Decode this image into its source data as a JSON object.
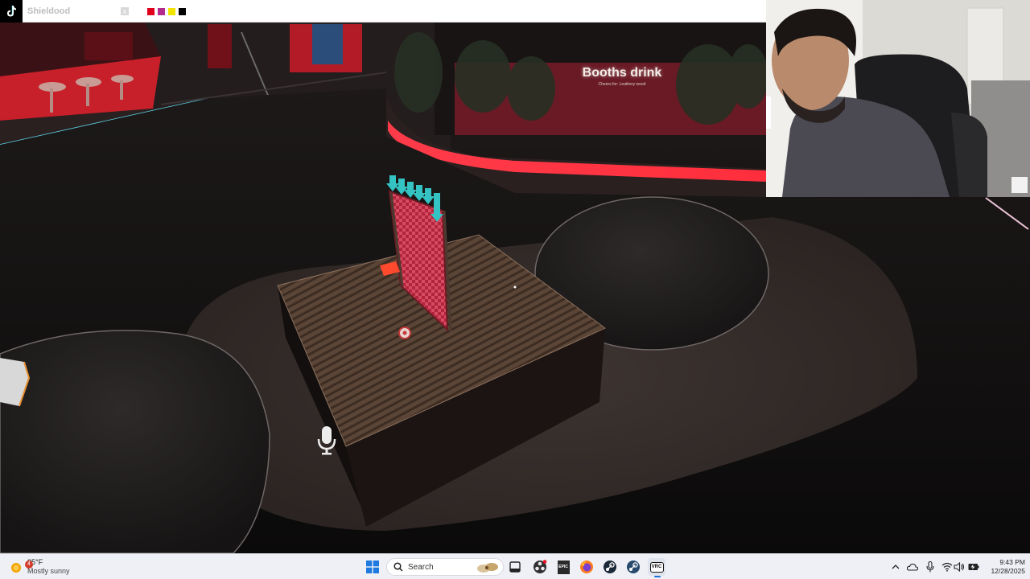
{
  "overlay": {
    "channel_name": "Shieldood",
    "close_label": "x",
    "swatches": [
      "#e0001b",
      "#b32b8c",
      "#f2e300",
      "#000000"
    ]
  },
  "game": {
    "booth_sign_title": "Booths drink",
    "booth_sign_subtitle": "Cheers for: Leathery wood"
  },
  "taskbar": {
    "weather": {
      "temp": "85°F",
      "condition": "Mostly sunny",
      "badge": "4"
    },
    "search_placeholder": "Search",
    "pinned": [
      "windows-start",
      "search",
      "widgets-sticker",
      "task-view",
      "obs",
      "epic-games",
      "firefox",
      "steam",
      "steam-vr",
      "vrchat"
    ],
    "vrchat_label": "VRC",
    "epic_label": "EPIC",
    "clock": {
      "time": "9:43 PM",
      "date": "12/28/2025"
    }
  }
}
